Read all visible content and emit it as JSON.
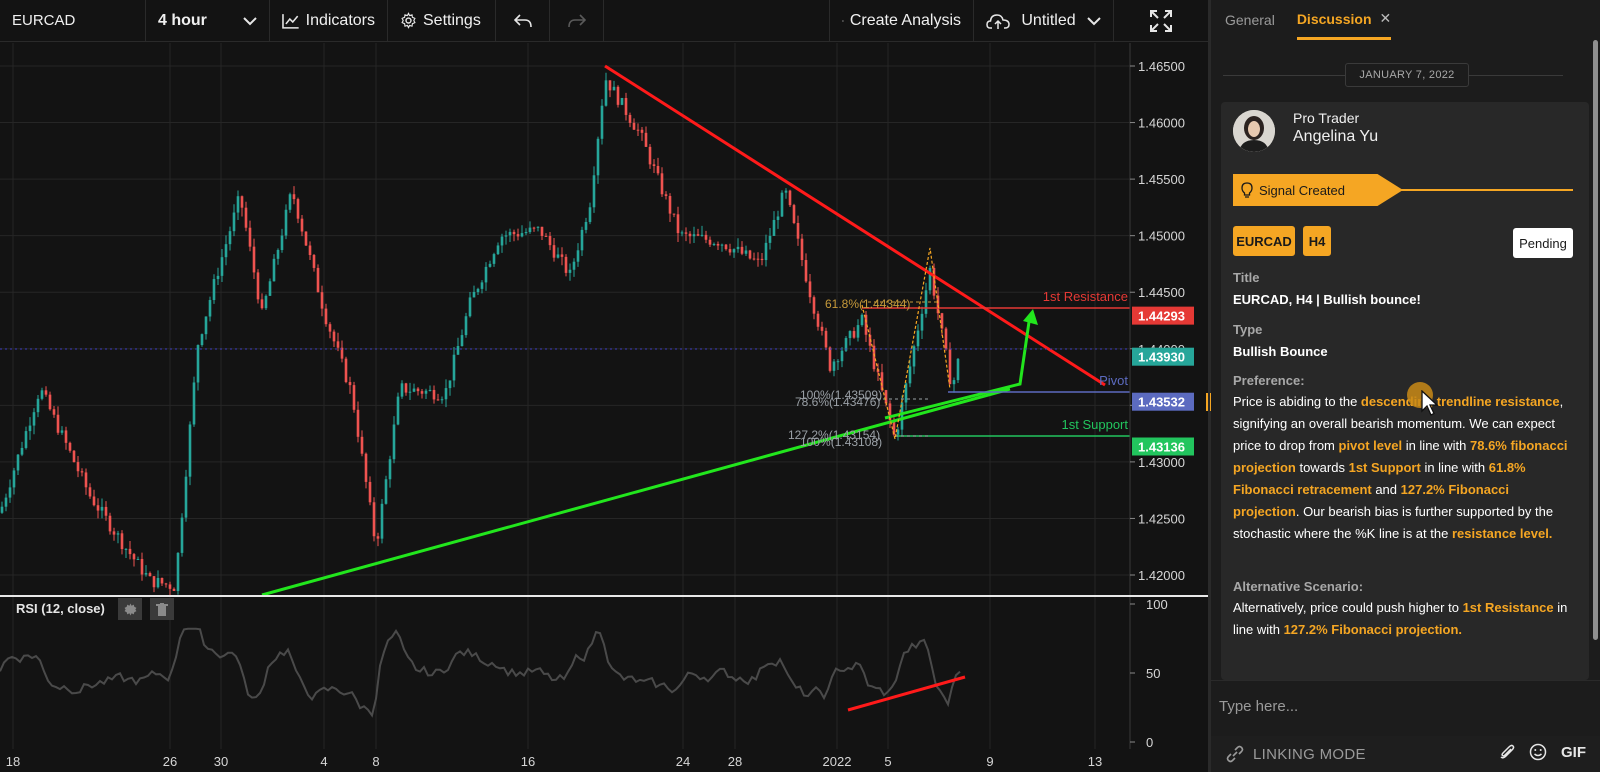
{
  "toolbar": {
    "symbol": "EURCAD",
    "timeframe": "4 hour",
    "indicators": "Indicators",
    "settings": "Settings",
    "create_analysis": "Create Analysis",
    "untitled": "Untitled"
  },
  "chart": {
    "price_ticks": [
      "1.46500",
      "1.46000",
      "1.45500",
      "1.45000",
      "1.44500",
      "1.44000",
      "1.43500",
      "1.43000",
      "1.42500",
      "1.42000"
    ],
    "price_labels": [
      {
        "text": "1.44293",
        "color": "#e53935"
      },
      {
        "text": "1.43930",
        "color": "#26a69a"
      },
      {
        "text": "1.43532",
        "color": "#5c6bc0"
      },
      {
        "text": "1.43136",
        "color": "#22c55e"
      }
    ],
    "level_labels": {
      "resistance": "1st Resistance",
      "pivot": "Pivot",
      "support": "1st Support"
    },
    "fib_labels": {
      "retracement": "61.8%(1.44344)",
      "fib100": "100%(1.43509)",
      "fib786": "78.6%(1.43476)",
      "fib1272": "127.2%(1.43154)",
      "fib100b": "100%(1.43108)"
    },
    "date_ticks": [
      "18",
      "26",
      "30",
      "4",
      "8",
      "16",
      "24",
      "28",
      "2022",
      "5",
      "9",
      "13"
    ],
    "rsi": {
      "label": "RSI (12, close)",
      "ticks": [
        "100",
        "50",
        "0"
      ]
    },
    "colors": {
      "candle_up": "#26a69a",
      "candle_down": "#ef5350",
      "trend_down": "#ff1a1a",
      "trend_up": "#22e61d"
    }
  },
  "panel": {
    "tabs": [
      "General",
      "Discussion"
    ],
    "date": "JANUARY 7, 2022",
    "author_role": "Pro Trader",
    "author_name": "Angelina Yu",
    "signal": "Signal Created",
    "tags": [
      "EURCAD",
      "H4"
    ],
    "status": "Pending",
    "title_label": "Title",
    "title_value": "EURCAD, H4 | Bullish bounce!",
    "type_label": "Type",
    "type_value": "Bullish Bounce",
    "preference_label": "Preference:",
    "preference": [
      {
        "t": "Price is abiding to the ",
        "h": false
      },
      {
        "t": "descending trendline resistance",
        "h": true
      },
      {
        "t": ", signifying an overall bearish momentum. We can expect price to drop from ",
        "h": false
      },
      {
        "t": "pivot level",
        "h": true
      },
      {
        "t": " in line with ",
        "h": false
      },
      {
        "t": "78.6% fibonacci projection",
        "h": true
      },
      {
        "t": " towards ",
        "h": false
      },
      {
        "t": "1st Support",
        "h": true
      },
      {
        "t": " in line with ",
        "h": false
      },
      {
        "t": "61.8% Fibonacci retracement",
        "h": true
      },
      {
        "t": " and ",
        "h": false
      },
      {
        "t": "127.2% Fibonacci projection",
        "h": true
      },
      {
        "t": ". Our bearish bias is further supported by the stochastic where the %K line is at the ",
        "h": false
      },
      {
        "t": "resistance level.",
        "h": true
      }
    ],
    "alternative_label": "Alternative Scenario:",
    "alternative": [
      {
        "t": "Alternatively, price could push higher to ",
        "h": false
      },
      {
        "t": "1st Resistance",
        "h": true
      },
      {
        "t": " in line with ",
        "h": false
      },
      {
        "t": "127.2% Fibonacci projection.",
        "h": true
      }
    ],
    "input_placeholder": "Type here...",
    "linking_mode": "LINKING MODE",
    "gif": "GIF"
  }
}
